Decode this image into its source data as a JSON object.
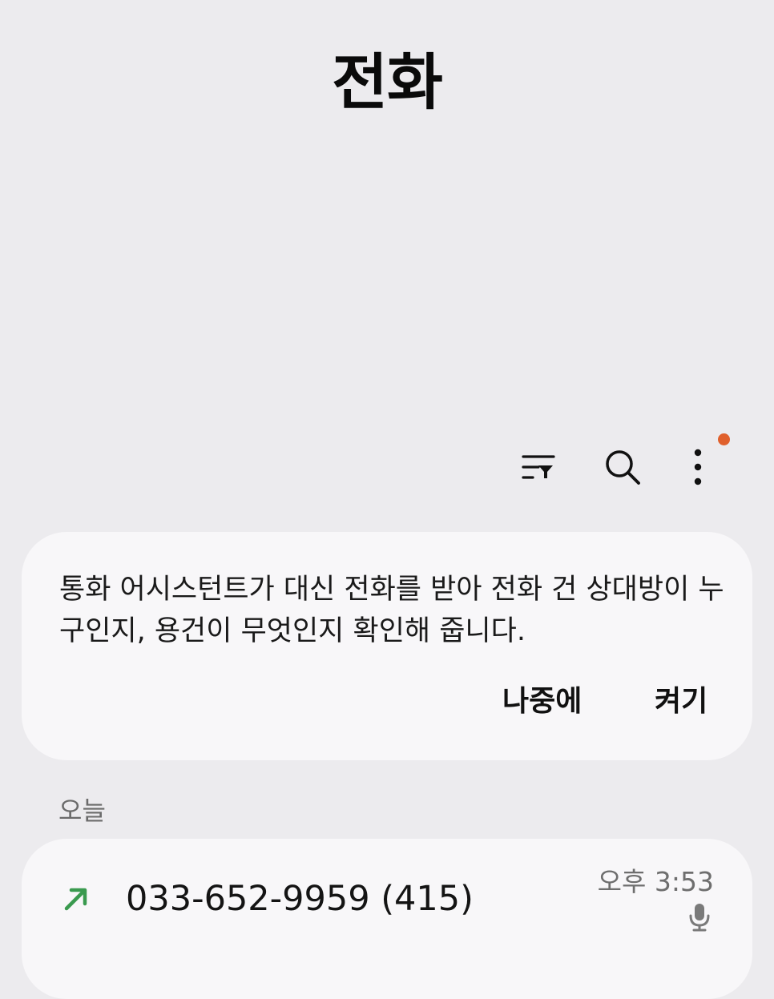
{
  "header": {
    "title": "전화"
  },
  "toolbar": {
    "filter_icon": "filter-list-icon",
    "search_icon": "search-icon",
    "more_icon": "more-vertical-icon",
    "has_notification": true,
    "notification_color": "#e0602c"
  },
  "assistant_card": {
    "message": "통화 어시스턴트가 대신 전화를 받아 전화 건 상대방이 누구인지, 용건이 무엇인지 확인해 줍니다.",
    "later_label": "나중에",
    "enable_label": "켜기"
  },
  "call_log": {
    "section_label": "오늘",
    "entries": [
      {
        "direction_icon": "outgoing-call-arrow-icon",
        "direction_color": "#3a9a4f",
        "number": "033-652-9959 (415)",
        "time": "오후 3:53",
        "recording_icon": "microphone-icon"
      }
    ]
  }
}
